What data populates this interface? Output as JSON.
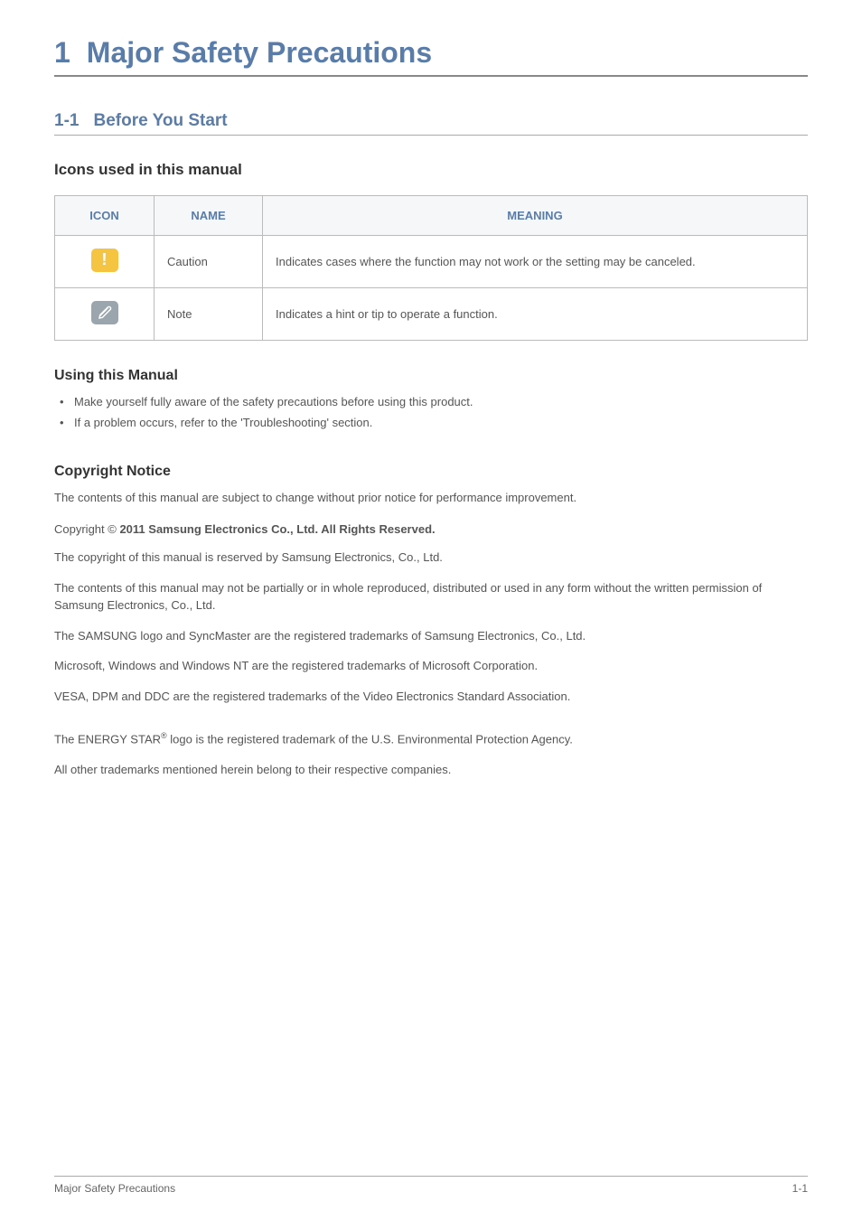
{
  "chapter": {
    "number": "1",
    "title": "Major Safety Precautions"
  },
  "section": {
    "number": "1-1",
    "title": "Before You Start"
  },
  "icons_section": {
    "heading": "Icons used in this manual",
    "table": {
      "headers": {
        "icon": "ICON",
        "name": "NAME",
        "meaning": "MEANING"
      },
      "rows": [
        {
          "icon_name": "caution-icon",
          "name": "Caution",
          "meaning": "Indicates cases where the function may not work or the setting may be canceled."
        },
        {
          "icon_name": "note-icon",
          "name": "Note",
          "meaning": "Indicates a hint or tip to operate a function."
        }
      ]
    }
  },
  "using_manual": {
    "heading": "Using this Manual",
    "bullets": [
      "Make yourself fully aware of the safety precautions before using this product.",
      "If a problem occurs, refer to the 'Troubleshooting' section."
    ]
  },
  "copyright": {
    "heading": "Copyright Notice",
    "intro": "The contents of this manual are subject to change without prior notice for performance improvement.",
    "line_prefix": "Copyright © ",
    "line_bold": "2011 Samsung Electronics Co., Ltd. All Rights Reserved.",
    "paragraphs": [
      "The copyright of this manual is reserved by Samsung Electronics, Co., Ltd.",
      "The contents of this manual may not be partially or in whole reproduced, distributed or used in any form without the written permission of Samsung Electronics, Co., Ltd.",
      "The SAMSUNG logo and SyncMaster are the registered trademarks of Samsung Electronics, Co., Ltd.",
      "Microsoft, Windows and Windows NT are the registered trademarks of Microsoft Corporation.",
      "VESA, DPM and DDC are the registered trademarks of the Video Electronics Standard Association."
    ],
    "energy_star_prefix": "The ENERGY STAR",
    "energy_star_suffix": " logo is the registered trademark of the U.S. Environmental Protection Agency.",
    "trademarks_other": "All other trademarks mentioned herein belong to their respective companies."
  },
  "footer": {
    "left": "Major Safety Precautions",
    "right": "1-1"
  }
}
